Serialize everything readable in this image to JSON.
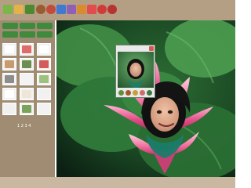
{
  "toolbar": {
    "icons": [
      {
        "name": "new-icon",
        "color": "#7ab648"
      },
      {
        "name": "open-folder-icon",
        "color": "#e3b24a"
      },
      {
        "name": "leaf-icon",
        "color": "#4c8a2f"
      },
      {
        "name": "frame-icon",
        "color": "#9a5b2f"
      },
      {
        "name": "flower-icon",
        "color": "#c44a3d"
      },
      {
        "name": "photo-icon",
        "color": "#3f7ad0"
      },
      {
        "name": "effects-icon",
        "color": "#8f5fb8"
      },
      {
        "name": "stamp-icon",
        "color": "#d98b2d"
      },
      {
        "name": "color-icon",
        "color": "#e34c4c"
      },
      {
        "name": "help-icon",
        "color": "#d23a3a"
      },
      {
        "name": "close-icon",
        "color": "#b83232"
      }
    ]
  },
  "sidebar": {
    "buttons": [
      "",
      "",
      "",
      "",
      "",
      ""
    ],
    "thumbnails": [
      "#ffffff",
      "#e06b6b",
      "#ffffff",
      "#c79b6b",
      "#6a8f4f",
      "#d65a5a",
      "#8d8d8d",
      "#f3f3f3",
      "#9ec27d",
      "#ffffff",
      "#f0e6d8",
      "#f1f1f1",
      "#f0f0f0",
      "#7aa35b",
      "#f2f2f2"
    ],
    "pager": "1 2 3 4"
  },
  "popup": {
    "title": "",
    "icons": [
      {
        "name": "rotate-icon",
        "color": "#5f8f3a"
      },
      {
        "name": "brush-icon",
        "color": "#a05a2c"
      },
      {
        "name": "star-icon",
        "color": "#c4a13a"
      },
      {
        "name": "palette-icon",
        "color": "#d16b6b"
      },
      {
        "name": "check-icon",
        "color": "#3b7a3b"
      }
    ]
  },
  "colors": {
    "toolbar": "#b49e84",
    "sidebar": "#a08c72",
    "canvas": "#0f2a17",
    "lotus_pink": "#e14d86",
    "leaf_green": "#3f8b44"
  }
}
